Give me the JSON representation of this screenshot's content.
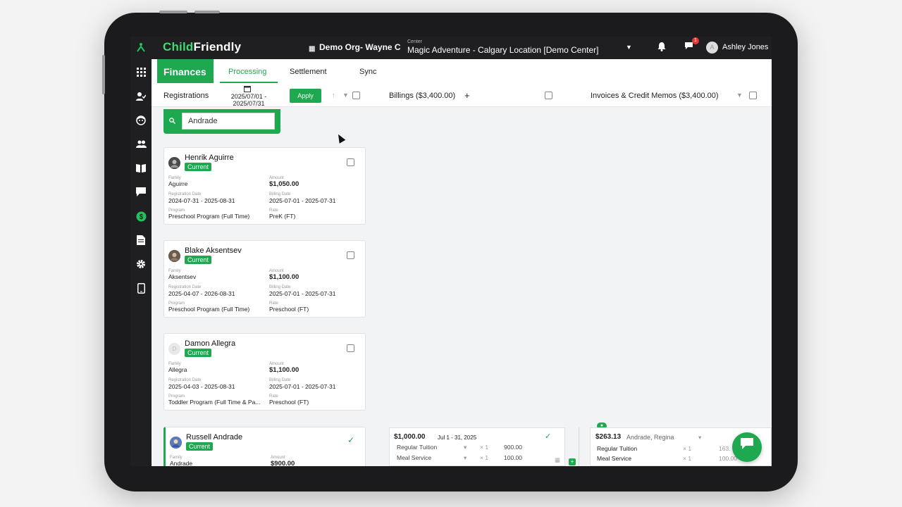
{
  "app": {
    "logo_part1": "Child",
    "logo_part2": "Friendly",
    "org": "Demo Org- Wayne C",
    "center_label": "Center",
    "center_value": "Magic Adventure - Calgary Location [Demo Center]",
    "notification_count": "1",
    "user_initial": "A",
    "user_name": "Ashley Jones"
  },
  "sidebar": {
    "icons": [
      "apps-grid-icon",
      "checkin-icon",
      "child-icon",
      "people-icon",
      "learning-book-icon",
      "messages-icon",
      "finances-dollar-icon",
      "document-icon",
      "settings-gear-icon",
      "tablet-icon"
    ],
    "active": "finances-dollar-icon"
  },
  "header": {
    "section": "Finances",
    "tabs": [
      "Processing",
      "Settlement",
      "Sync"
    ],
    "active_tab": "Processing"
  },
  "toolbar": {
    "registrations_label": "Registrations",
    "date_range_line1": "2025/07/01 -",
    "date_range_line2": "2025/07/31",
    "apply_label": "Apply",
    "billings_label": "Billings ($3,400.00)",
    "invoices_label": "Invoices & Credit Memos ($3,400.00)"
  },
  "search": {
    "value": "Andrade",
    "placeholder": "Search"
  },
  "field_labels": {
    "family": "Family",
    "amount": "Amount",
    "registration_date": "Registration Date",
    "billing_date": "Billing Date",
    "program": "Program",
    "rate": "Rate"
  },
  "registrations": [
    {
      "name": "Henrik Aguirre",
      "status": "Current",
      "family": "Aguirre",
      "amount": "$1,050.00",
      "registration_date": "2024-07-31 - 2025-08-31",
      "billing_date": "2025-07-01 - 2025-07-31",
      "program": "Preschool Program (Full Time)",
      "rate": "PreK (FT)",
      "checked": false
    },
    {
      "name": "Blake Aksentsev",
      "status": "Current",
      "family": "Aksentsev",
      "amount": "$1,100.00",
      "registration_date": "2025-04-07 - 2026-08-31",
      "billing_date": "2025-07-01 - 2025-07-31",
      "program": "Preschool Program (Full Time)",
      "rate": "Preschool (FT)",
      "checked": false
    },
    {
      "name": "Damon Allegra",
      "initial": "D",
      "status": "Current",
      "family": "Allegra",
      "amount": "$1,100.00",
      "registration_date": "2025-04-03 - 2025-08-31",
      "billing_date": "2025-07-01 - 2025-07-31",
      "program": "Toddler Program (Full Time & Pa...",
      "rate": "Preschool (FT)",
      "checked": false
    },
    {
      "name": "Russell Andrade",
      "status": "Current",
      "family": "Andrade",
      "amount": "$900.00",
      "checked": true
    }
  ],
  "billing": {
    "amount": "$1,000.00",
    "period": "Jul 1 - 31, 2025",
    "lines": [
      {
        "item": "Regular Tuition",
        "qty": "× 1",
        "price": "900.00"
      },
      {
        "item": "Meal Service",
        "qty": "× 1",
        "price": "100.00"
      }
    ]
  },
  "invoice": {
    "amount": "$263.13",
    "family": "Andrade, Regina",
    "lines": [
      {
        "item": "Regular Tuition",
        "qty": "× 1",
        "price": "163."
      },
      {
        "item": "Meal Service",
        "qty": "× 1",
        "price": "100.00"
      }
    ]
  },
  "colors": {
    "brand_green": "#1ea84f",
    "dark_bar": "#1f1f22"
  }
}
